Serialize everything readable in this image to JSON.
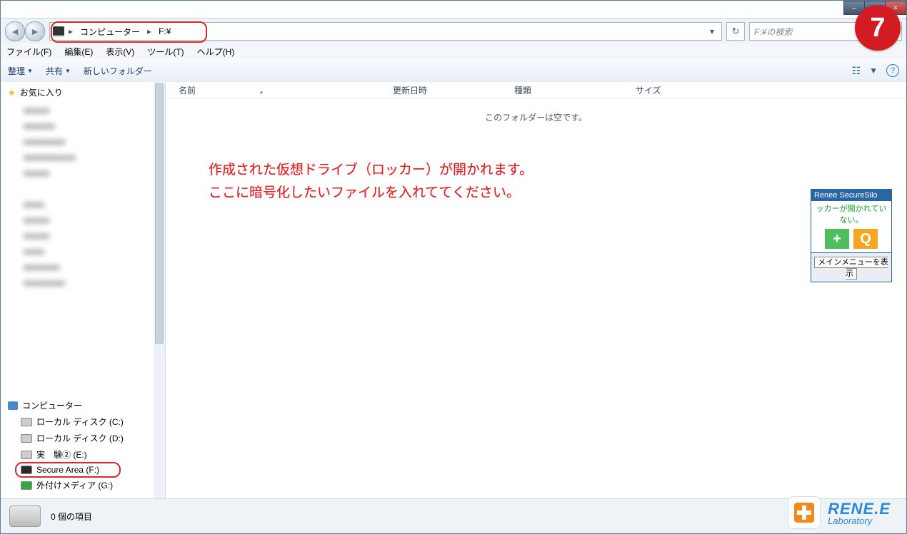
{
  "window": {
    "minimize": "–",
    "maximize": "□",
    "close": "×"
  },
  "nav": {
    "back": "◄",
    "forward": "►",
    "seg1": "コンピューター",
    "seg2": "F:¥",
    "dropdown": "▾",
    "refresh": "↻"
  },
  "search": {
    "placeholder": "F:¥の検索"
  },
  "menu": {
    "file": "ファイル(F)",
    "edit": "編集(E)",
    "view": "表示(V)",
    "tools": "ツール(T)",
    "help": "ヘルプ(H)"
  },
  "toolbar": {
    "organize": "整理",
    "share": "共有",
    "newfolder": "新しいフォルダー",
    "caret": "▼",
    "views": "☷",
    "help": "?"
  },
  "columns": {
    "name": "名前",
    "date": "更新日時",
    "type": "種類",
    "size": "サイズ"
  },
  "content": {
    "empty": "このフォルダーは空です。"
  },
  "annotation": {
    "l1": "作成された仮想ドライブ（ロッカー）が開かれます。",
    "l2": "ここに暗号化したいファイルを入れててください。"
  },
  "sidebar": {
    "favorites": "お気に入り",
    "computer": "コンピューター",
    "drives": [
      {
        "label": "ローカル ディスク (C:)",
        "icon": "c"
      },
      {
        "label": "ローカル ディスク (D:)",
        "icon": "d"
      },
      {
        "label": "実　験② (E:)",
        "icon": "d"
      },
      {
        "label": "Secure Area (F:)",
        "icon": "dark",
        "hl": true
      },
      {
        "label": "外付けメディア (G:)",
        "icon": "green"
      }
    ]
  },
  "panel": {
    "title": "Renee SecureSilo",
    "status": "ッカーが開かれていない。",
    "add": "+",
    "q": "Q",
    "menu": "メインメニューを表示"
  },
  "status": {
    "items": "0 個の項目"
  },
  "badge": "7",
  "logo": {
    "l1": "RENE.E",
    "l2": "Laboratory"
  }
}
